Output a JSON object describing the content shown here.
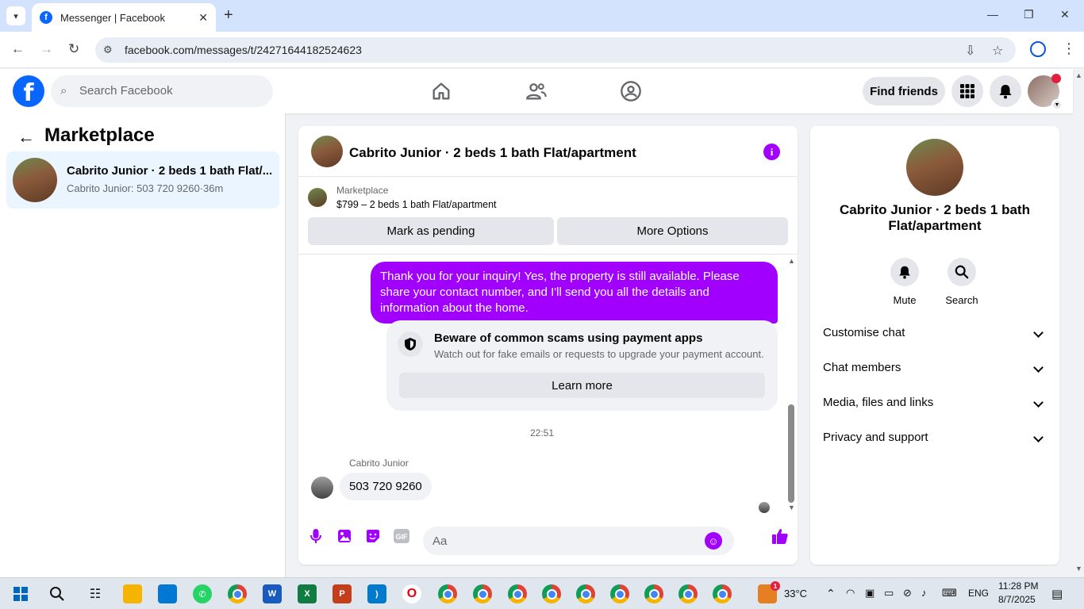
{
  "browser": {
    "tab_title": "Messenger | Facebook",
    "url": "facebook.com/messages/t/24271644182524623"
  },
  "fb_header": {
    "logo": "f",
    "search_placeholder": "Search Facebook",
    "find_friends": "Find friends",
    "icons": [
      "home-icon",
      "friends-icon",
      "groups-icon",
      "menu-grid-icon",
      "bell-icon"
    ]
  },
  "sidebar": {
    "title": "Marketplace",
    "conversations": [
      {
        "name": "Cabrito Junior · 2 beds 1 bath Flat/...",
        "preview": "Cabrito Junior: 503 720 9260·36m"
      }
    ]
  },
  "chat": {
    "title": "Cabrito Junior · 2 beds 1 bath Flat/apartment",
    "marketplace": {
      "label": "Marketplace",
      "item": "$799 – 2 beds 1 bath Flat/apartment",
      "mark_pending": "Mark as pending",
      "more_options": "More Options"
    },
    "outgoing_message": "Thank you for your inquiry! Yes, the property is still available. Please share your contact number, and I'll send you all the details and information about the home.",
    "warning": {
      "title": "Beware of common scams using payment apps",
      "subtitle": "Watch out for fake emails or requests to upgrade your payment account.",
      "button": "Learn more"
    },
    "timestamp": "22:51",
    "sender": "Cabrito Junior",
    "incoming_message": "503 720 9260",
    "composer_placeholder": "Aa"
  },
  "details": {
    "name": "Cabrito Junior · 2 beds 1 bath Flat/apartment",
    "actions": {
      "mute": "Mute",
      "search": "Search"
    },
    "sections": [
      "Customise chat",
      "Chat members",
      "Media, files and links",
      "Privacy and support"
    ]
  },
  "taskbar": {
    "weather": "33°C",
    "notification_badge": "1",
    "language": "ENG",
    "time": "11:28 PM",
    "date": "8/7/2025"
  },
  "colors": {
    "accent": "#a100ff",
    "fb_blue": "#0866ff"
  }
}
